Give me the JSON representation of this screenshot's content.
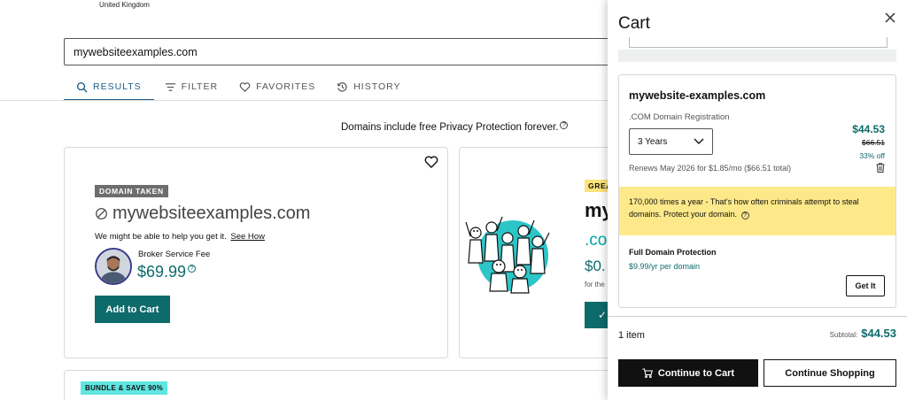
{
  "header": {
    "country": "United Kingdom"
  },
  "search": {
    "value": "mywebsiteexamples.com"
  },
  "tabs": [
    {
      "label": "RESULTS",
      "icon": "search-icon",
      "active": true
    },
    {
      "label": "FILTER",
      "icon": "filter-icon",
      "active": false
    },
    {
      "label": "FAVORITES",
      "icon": "heart-icon",
      "active": false
    },
    {
      "label": "HISTORY",
      "icon": "history-icon",
      "active": false
    }
  ],
  "privacy_note": "Domains include free Privacy Protection forever.",
  "taken_card": {
    "badge": "DOMAIN TAKEN",
    "domain": "mywebsiteexamples.com",
    "help_text": "We might be able to help you get it.",
    "help_link": "See How",
    "broker_label": "Broker Service Fee",
    "broker_price": "$69.99",
    "add_button": "Add to Cart"
  },
  "suggestion_card": {
    "badge": "GREA",
    "domain_partial": "my",
    "tld_partial": ".co",
    "price_partial": "$0.",
    "term_partial": "for the",
    "added_icon": "checkmark-icon"
  },
  "bundle_card": {
    "badge": "BUNDLE & SAVE 90%"
  },
  "cart": {
    "title": "Cart",
    "item": {
      "domain": "mywebsite-examples.com",
      "type": ".COM Domain Registration",
      "term": "3 Years",
      "price": "$44.53",
      "old_price": "$66.51",
      "discount": "33% off",
      "renews": "Renews May 2026 for $1.85/mo ($66.51 total)"
    },
    "warning": "170,000 times a year - That's how often criminals attempt to steal domains. Protect your domain.",
    "upsell": {
      "label": "Full Domain Protection",
      "price": "$9.99/yr per domain",
      "button": "Get It"
    },
    "item_count": "1 item",
    "subtotal_label": "Subtotal:",
    "subtotal_value": "$44.53",
    "continue_cart": "Continue to Cart",
    "continue_shopping": "Continue Shopping"
  },
  "colors": {
    "accent": "#0e6b6b",
    "link_active": "#1a5d8a",
    "warning_bg": "#fde98a",
    "teal_illustration": "#2cc5c8"
  }
}
